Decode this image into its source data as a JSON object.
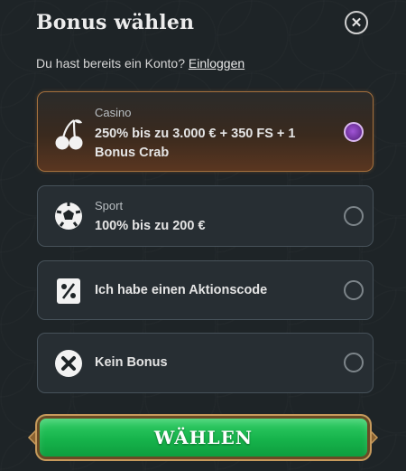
{
  "header": {
    "title": "Bonus wählen"
  },
  "subtitle": {
    "text": "Du hast bereits ein Konto?",
    "link": "Einloggen"
  },
  "options": [
    {
      "category": "Casino",
      "title": "250% bis zu 3.000 € + 350 FS + 1 Bonus Crab",
      "icon": "cherries-icon",
      "selected": true
    },
    {
      "category": "Sport",
      "title": "100% bis zu 200 €",
      "icon": "soccer-ball-icon",
      "selected": false
    },
    {
      "category": "",
      "title": "Ich habe einen Aktionscode",
      "icon": "percent-icon",
      "selected": false
    },
    {
      "category": "",
      "title": "Kein Bonus",
      "icon": "no-bonus-x-icon",
      "selected": false
    }
  ],
  "submit": {
    "label": "WÄHLEN"
  },
  "colors": {
    "accent": "#a5703d",
    "button_green": "#16b34b",
    "radio_selected": "#8a3fbf"
  }
}
